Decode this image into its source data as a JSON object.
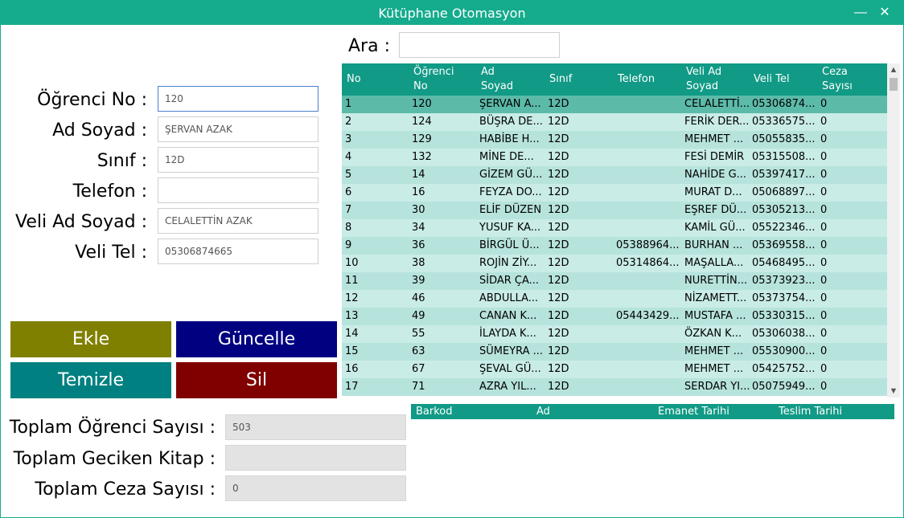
{
  "window": {
    "title": "Kütüphane Otomasyon",
    "minimize_glyph": "—",
    "close_glyph": "✕"
  },
  "search": {
    "label": "Ara :",
    "value": ""
  },
  "form": {
    "student_no_label": "Öğrenci No :",
    "student_no_value": "120",
    "name_label": "Ad Soyad :",
    "name_value": "ŞERVAN AZAK",
    "class_label": "Sınıf :",
    "class_value": "12D",
    "phone_label": "Telefon :",
    "phone_value": "",
    "parent_name_label": "Veli Ad Soyad :",
    "parent_name_value": "CELALETTİN AZAK",
    "parent_phone_label": "Veli Tel :",
    "parent_phone_value": "05306874665"
  },
  "buttons": {
    "add": "Ekle",
    "update": "Güncelle",
    "clear": "Temizle",
    "delete": "Sil"
  },
  "colors": {
    "add": "#808000",
    "update": "#000080",
    "clear": "#008080",
    "delete": "#800000",
    "accent": "#15ab8d"
  },
  "stats": {
    "total_students_label": "Toplam Öğrenci Sayısı :",
    "total_students_value": "503",
    "total_late_label": "Toplam Geciken Kitap :",
    "total_late_value": "",
    "total_fines_label": "Toplam Ceza Sayısı :",
    "total_fines_value": "0"
  },
  "students_table": {
    "columns": [
      "No",
      "Öğrenci\nNo",
      "Ad\nSoyad",
      "Sınıf",
      "Telefon",
      "Veli Ad\nSoyad",
      "Veli Tel",
      "Ceza\nSayısı"
    ],
    "rows": [
      [
        "1",
        "120",
        "ŞERVAN A...",
        "12D",
        "",
        "CELALETTİ...",
        "05306874...",
        "0"
      ],
      [
        "2",
        "124",
        "BÜŞRA DE...",
        "12D",
        "",
        "FERİK DER...",
        "05336575...",
        "0"
      ],
      [
        "3",
        "129",
        "HABİBE H...",
        "12D",
        "",
        "MEHMET ...",
        "05055835...",
        "0"
      ],
      [
        "4",
        "132",
        "MİNE DE...",
        "12D",
        "",
        "FESİ DEMİR",
        "05315508...",
        "0"
      ],
      [
        "5",
        "14",
        "GİZEM GÜ...",
        "12D",
        "",
        "NAHİDE G...",
        "05397417...",
        "0"
      ],
      [
        "6",
        "16",
        "FEYZA DO...",
        "12D",
        "",
        "MURAT D...",
        "05068897...",
        "0"
      ],
      [
        "7",
        "30",
        "ELİF DÜZEN",
        "12D",
        "",
        "EŞREF DÜ...",
        "05305213...",
        "0"
      ],
      [
        "8",
        "34",
        "YUSUF KA...",
        "12D",
        "",
        "KAMİL GÜ...",
        "05522346...",
        "0"
      ],
      [
        "9",
        "36",
        "BİRGÜL Ü...",
        "12D",
        "05388964...",
        "BURHAN ...",
        "05369558...",
        "0"
      ],
      [
        "10",
        "38",
        "ROJİN ZİY...",
        "12D",
        "05314864...",
        "MAŞALLA...",
        "05468495...",
        "0"
      ],
      [
        "11",
        "39",
        "SİDAR ÇA...",
        "12D",
        "",
        "NURETTİN...",
        "05373923...",
        "0"
      ],
      [
        "12",
        "46",
        "ABDULLA...",
        "12D",
        "",
        "NİZAMETT...",
        "05373754...",
        "0"
      ],
      [
        "13",
        "49",
        "CANAN K...",
        "12D",
        "05443429...",
        "MUSTAFA ...",
        "05330315...",
        "0"
      ],
      [
        "14",
        "55",
        "İLAYDA K...",
        "12D",
        "",
        "ÖZKAN K...",
        "05306038...",
        "0"
      ],
      [
        "15",
        "63",
        "SÜMEYRA ...",
        "12D",
        "",
        "MEHMET ...",
        "05530900...",
        "0"
      ],
      [
        "16",
        "67",
        "ŞEVAL GÜ...",
        "12D",
        "",
        "MEHMET ...",
        "05425752...",
        "0"
      ],
      [
        "17",
        "71",
        "AZRA YIL...",
        "12D",
        "",
        "SERDAR YI...",
        "05075949...",
        "0"
      ]
    ]
  },
  "loans_table": {
    "columns": [
      "Barkod",
      "Ad",
      "Emanet Tarihi",
      "Teslim Tarihi"
    ]
  },
  "scrollbar": {
    "up_glyph": "▲",
    "down_glyph": "▼"
  }
}
